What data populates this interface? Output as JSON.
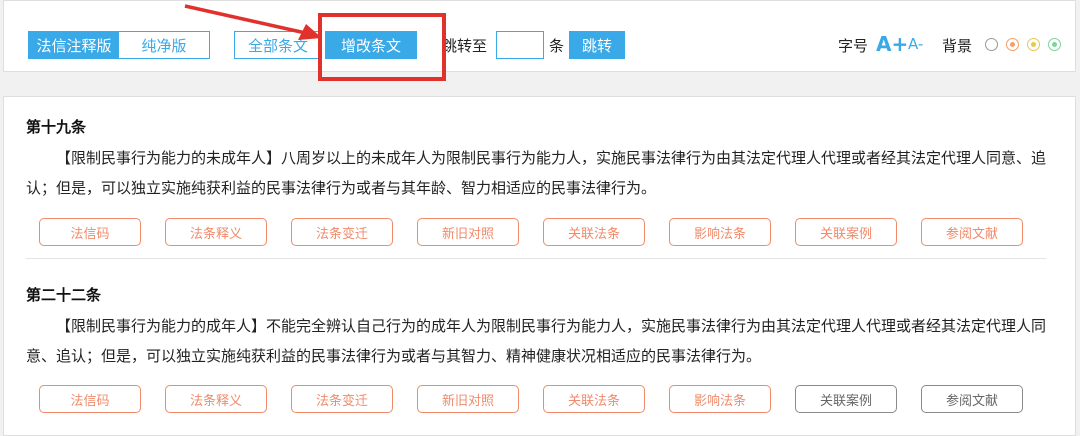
{
  "toolbar": {
    "mode_annotated": "法信注释版",
    "mode_plain": "纯净版",
    "all_articles": "全部条文",
    "amended_articles": "增改条文",
    "jump_to": "跳转至",
    "jump_value": "",
    "unit": "条",
    "jump_button": "跳转",
    "font_size_label": "字号",
    "font_increase": "A+",
    "font_decrease": "A-",
    "background_label": "背景",
    "background_colors": [
      "#ffffff",
      "#f0a06a",
      "#e6c94a",
      "#7fd29a"
    ]
  },
  "annotation": {
    "color": "#e0312c"
  },
  "articles": [
    {
      "title": "第十九条",
      "body": "【限制民事行为能力的未成年人】八周岁以上的未成年人为限制民事行为能力人，实施民事法律行为由其法定代理人代理或者经其法定代理人同意、追认；但是，可以独立实施纯获利益的民事法律行为或者与其年龄、智力相适应的民事法律行为。",
      "actions": [
        "法信码",
        "法条释义",
        "法条变迁",
        "新旧对照",
        "关联法条",
        "影响法条",
        "关联案例",
        "参阅文献"
      ]
    },
    {
      "title": "第二十二条",
      "body": "【限制民事行为能力的成年人】不能完全辨认自己行为的成年人为限制民事行为能力人，实施民事法律行为由其法定代理人代理或者经其法定代理人同意、追认；但是，可以独立实施纯获利益的民事法律行为或者与其智力、精神健康状况相适应的民事法律行为。",
      "actions": [
        "法信码",
        "法条释义",
        "法条变迁",
        "新旧对照",
        "关联法条",
        "影响法条",
        "关联案例",
        "参阅文献"
      ]
    }
  ]
}
